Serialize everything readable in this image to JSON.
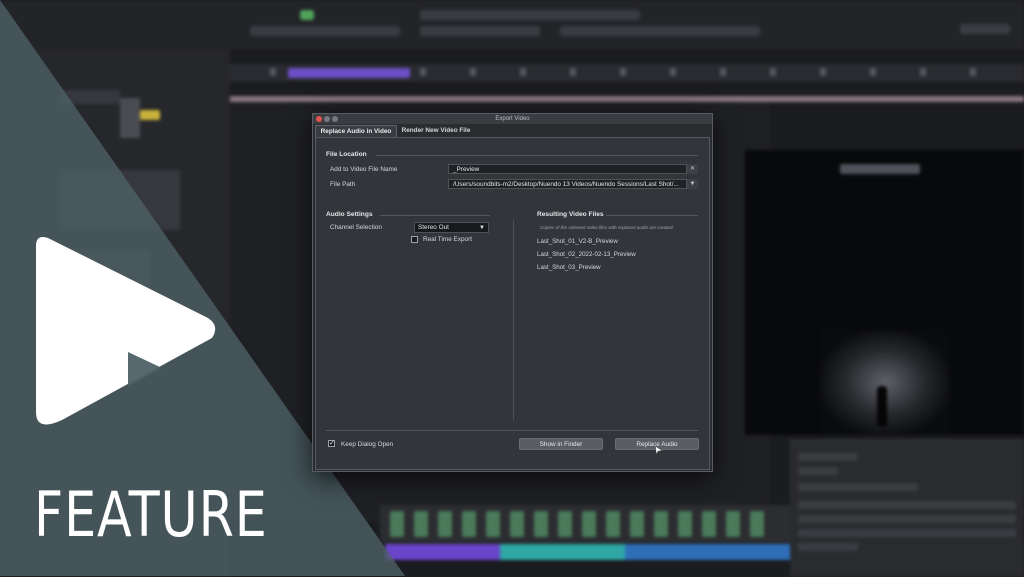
{
  "dialog": {
    "title": "Export Video",
    "tabs": [
      "Replace Audio in Video",
      "Render New Video File"
    ],
    "file_location": {
      "heading": "File Location",
      "add_name_label": "Add to Video File Name",
      "add_name_value": "_Preview",
      "file_path_label": "File Path",
      "file_path_value": "/Users/soundbits-m2/Desktop/Nuendo 13 Videos/Nuendo Sessions/Last Shot/..."
    },
    "audio_settings": {
      "heading": "Audio Settings",
      "channel_label": "Channel Selection",
      "channel_value": "Stereo Out",
      "realtime_label": "Real Time Export",
      "realtime_checked": false
    },
    "resulting": {
      "heading": "Resulting Video Files",
      "note": "Copies of the selected video files with replaced audio are created.",
      "files": [
        "Last_Shot_01_V2-B_Preview",
        "Last_Shot_02_2022-02-13_Preview",
        "Last_Shot_03_Preview"
      ]
    },
    "footer": {
      "keep_open_label": "Keep Dialog Open",
      "keep_open_checked": true,
      "show_in_finder": "Show in Finder",
      "replace_audio": "Replace Audio"
    }
  },
  "overlay": {
    "feature_label": "FEATURE",
    "logo_icon": "nuendo-logo-icon",
    "triangle_color": "#4e6166"
  }
}
